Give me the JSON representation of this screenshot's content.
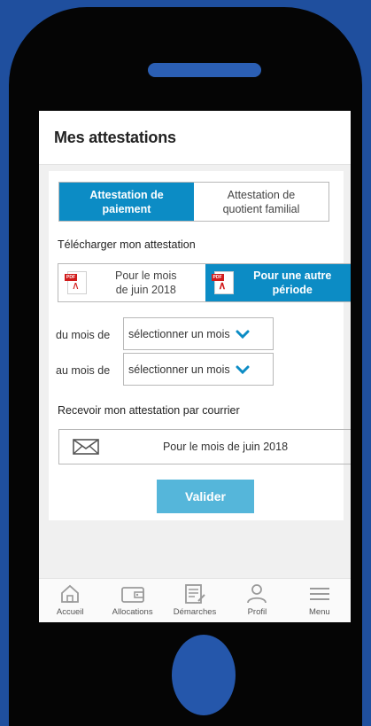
{
  "header": {
    "title": "Mes attestations"
  },
  "tabs": [
    {
      "label_line1": "Attestation de",
      "label_line2": "paiement",
      "active": true
    },
    {
      "label_line1": "Attestation de",
      "label_line2": "quotient familial",
      "active": false
    }
  ],
  "download": {
    "section_label": "Télécharger mon attestation",
    "options": [
      {
        "line1": "Pour le mois",
        "line2": "de juin 2018",
        "icon": "pdf-icon",
        "active": false
      },
      {
        "line1": "Pour une autre",
        "line2": "période",
        "icon": "pdf-icon",
        "active": true
      }
    ],
    "pdf_tag": "PDF"
  },
  "period": {
    "from_label": "du mois de",
    "to_label": "au mois de",
    "from_value": "sélectionner un mois",
    "to_value": "sélectionner un mois"
  },
  "mail": {
    "section_label": "Recevoir mon attestation par courrier",
    "option_label": "Pour le mois de juin 2018",
    "icon": "envelope-icon"
  },
  "submit_label": "Valider",
  "nav": [
    {
      "label": "Accueil",
      "icon": "home-icon"
    },
    {
      "label": "Allocations",
      "icon": "wallet-icon"
    },
    {
      "label": "Démarches",
      "icon": "document-icon"
    },
    {
      "label": "Profil",
      "icon": "user-icon"
    },
    {
      "label": "Menu",
      "icon": "menu-icon"
    }
  ],
  "colors": {
    "accent": "#0c8cc5",
    "button": "#55b6da",
    "frame_background": "#1f4f9e",
    "phone": "#050505"
  }
}
